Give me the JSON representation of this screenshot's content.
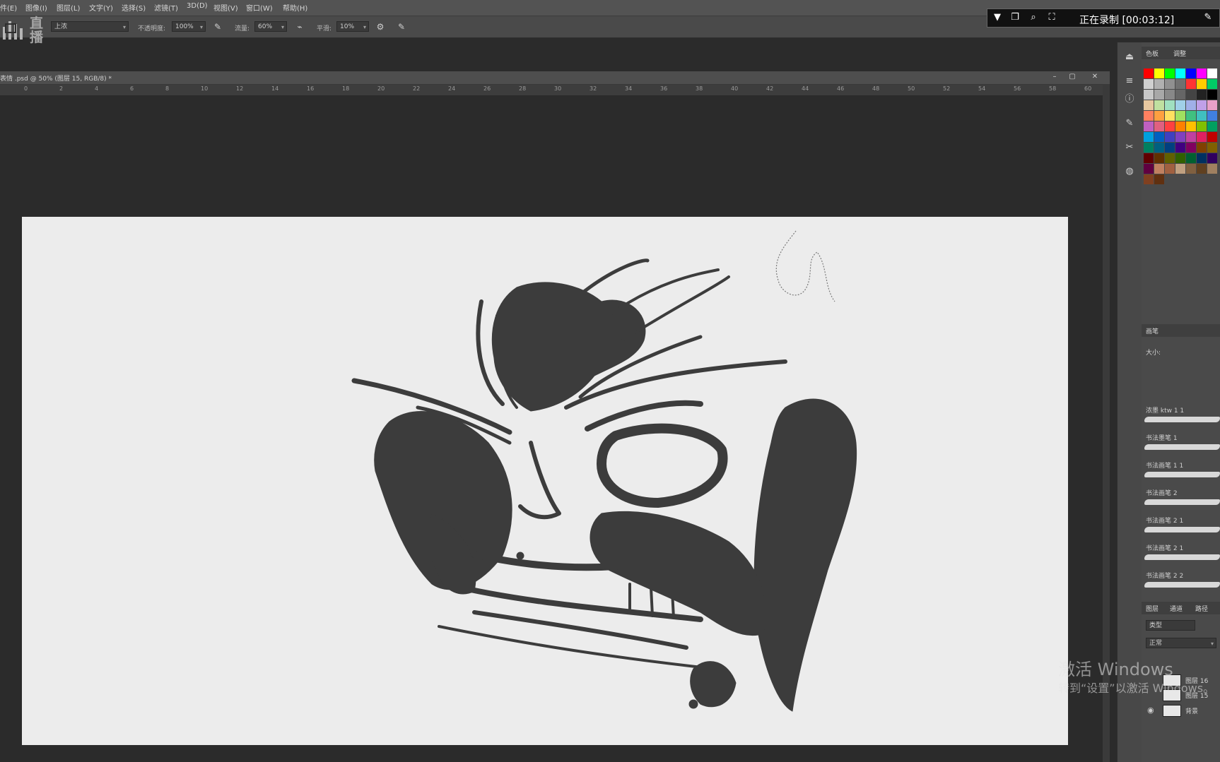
{
  "menu": {
    "items": [
      "件(E)",
      "图像(I)",
      "图层(L)",
      "文字(Y)",
      "选择(S)",
      "滤镜(T)",
      "3D(D)",
      "视图(V)",
      "窗口(W)",
      "帮助(H)"
    ]
  },
  "options_bar": {
    "preset_value": "上浓",
    "opacity_label": "不透明度:",
    "opacity_value": "100%",
    "flow_label": "流量:",
    "flow_value": "60%",
    "smoothing_label": "平滑:",
    "smoothing_value": "10%"
  },
  "watermark_logo": {
    "glyphs": [
      "直",
      "播"
    ]
  },
  "recorder": {
    "status_text": "正在录制 [00:03:12]"
  },
  "document": {
    "title": "表情 .psd @ 50% (图层 15, RGB/8) *"
  },
  "ruler": {
    "labels": [
      "0",
      "2",
      "4",
      "6",
      "8",
      "10",
      "12",
      "14",
      "16",
      "18",
      "20",
      "22",
      "24",
      "26",
      "28",
      "30",
      "32",
      "34",
      "36",
      "38",
      "40",
      "42",
      "44",
      "46",
      "48",
      "50",
      "52",
      "54",
      "56",
      "58",
      "60"
    ]
  },
  "right_panels": {
    "swatch_tabs": [
      "色板",
      "调整"
    ],
    "brush_panel_tab": "画笔",
    "size_label": "大小:",
    "brushes": [
      "浓墨 ktw 1 1",
      "书法墨笔 1",
      "书法画笔 1 1",
      "书法画笔 2",
      "书法画笔 2 1",
      "书法画笔 2 1",
      "书法画笔 2 2"
    ],
    "layer_tabs": [
      "图层",
      "通道",
      "路径"
    ],
    "kind_filter": "类型",
    "blend_mode": "正常",
    "layers": [
      "图层 16",
      "图层 15",
      "背景"
    ]
  },
  "swatch_colors": [
    [
      "#ff0000",
      "#ffff00",
      "#00ff00",
      "#00ffff",
      "#0000ff",
      "#ff00ff",
      "#ffffff"
    ],
    [
      "#d0d0d0",
      "#b0b0b0",
      "#909090",
      "#707070",
      "#ff3333",
      "#ffcc00",
      "#00cc66"
    ],
    [
      "#c8c8c8",
      "#a8a8a8",
      "#888888",
      "#666666",
      "#444444",
      "#222222",
      "#000000"
    ],
    [
      "#e8c8a0",
      "#c0e0a0",
      "#a0e0c0",
      "#a0d0e8",
      "#a0b0e8",
      "#c0a0e8",
      "#e8a0c8"
    ],
    [
      "#ff8060",
      "#ffa040",
      "#ffe060",
      "#a0e060",
      "#40c080",
      "#40c0c0",
      "#4080e0"
    ],
    [
      "#c060c0",
      "#e06080",
      "#ff4040",
      "#ff8000",
      "#ffc000",
      "#80c000",
      "#00a060"
    ],
    [
      "#00a0e0",
      "#0060c0",
      "#4040c0",
      "#8040c0",
      "#c040a0",
      "#e02060",
      "#c00000"
    ],
    [
      "#008060",
      "#006080",
      "#004080",
      "#400080",
      "#800060",
      "#804000",
      "#806000"
    ],
    [
      "#600000",
      "#603000",
      "#606000",
      "#306000",
      "#006030",
      "#003060",
      "#300060"
    ],
    [
      "#600040",
      "#c08060",
      "#a06040",
      "#c0a080",
      "#806040",
      "#604020",
      "#a08060"
    ],
    [
      "#804020",
      "#603010"
    ]
  ],
  "activation": {
    "title": "激活 Windows",
    "subtitle": "转到“设置”以激活 Windows。"
  }
}
